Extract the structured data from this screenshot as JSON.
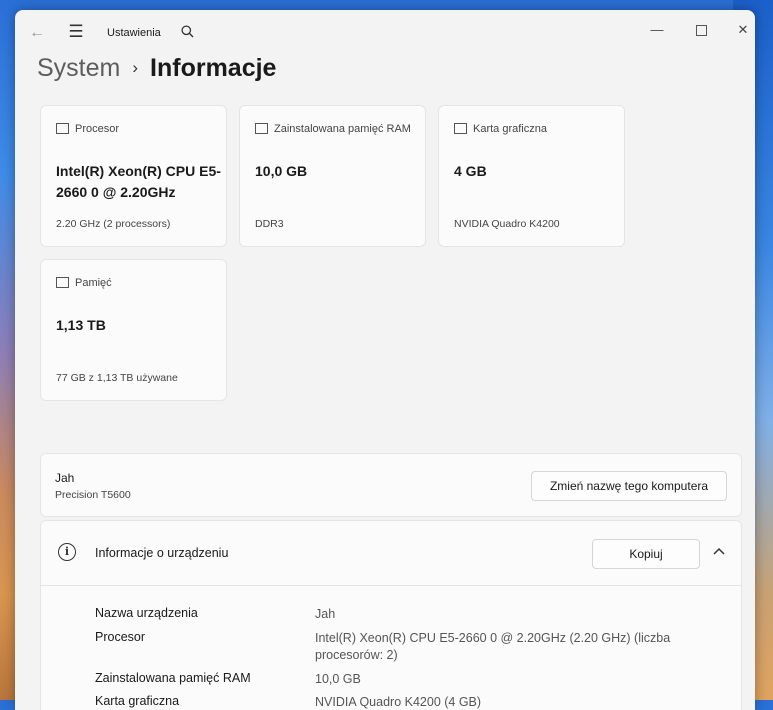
{
  "window": {
    "app_title": "Ustawienia",
    "icons": {
      "back": "arrow-left-icon",
      "menu": "hamburger-menu-icon",
      "search": "search-icon",
      "minimize": "minimize-icon",
      "maximize": "maximize-icon",
      "close": "close-icon"
    }
  },
  "breadcrumb": {
    "parent": "System",
    "separator": "›",
    "current": "Informacje"
  },
  "specs": [
    {
      "label": "Procesor",
      "value": "Intel(R) Xeon(R) CPU E5-2660 0 @ 2.20GHz",
      "sub": "2.20 GHz (2 processors)",
      "icon": "processor-icon"
    },
    {
      "label": "Zainstalowana pamięć RAM",
      "value": "10,0 GB",
      "sub": "DDR3",
      "icon": "ram-icon"
    },
    {
      "label": "Karta graficzna",
      "value": "4 GB",
      "sub": "NVIDIA Quadro K4200",
      "icon": "graphics-card-icon"
    },
    {
      "label": "Pamięć",
      "value": "1,13 TB",
      "sub": "77 GB z 1,13 TB używane",
      "icon": "storage-icon"
    }
  ],
  "computer": {
    "name": "Jah",
    "model": "Precision T5600",
    "rename_label": "Zmień nazwę tego komputera"
  },
  "device_info": {
    "title": "Informacje o urządzeniu",
    "copy_label": "Kopiuj",
    "rows": [
      {
        "label": "Nazwa urządzenia",
        "value": "Jah"
      },
      {
        "label": "Procesor",
        "value": "Intel(R) Xeon(R) CPU E5-2660 0 @ 2.20GHz (2.20 GHz) (liczba procesorów: 2)"
      },
      {
        "label": "Zainstalowana pamięć RAM",
        "value": "10,0 GB"
      },
      {
        "label": "Karta graficzna",
        "value": "NVIDIA Quadro K4200 (4 GB)"
      }
    ]
  }
}
